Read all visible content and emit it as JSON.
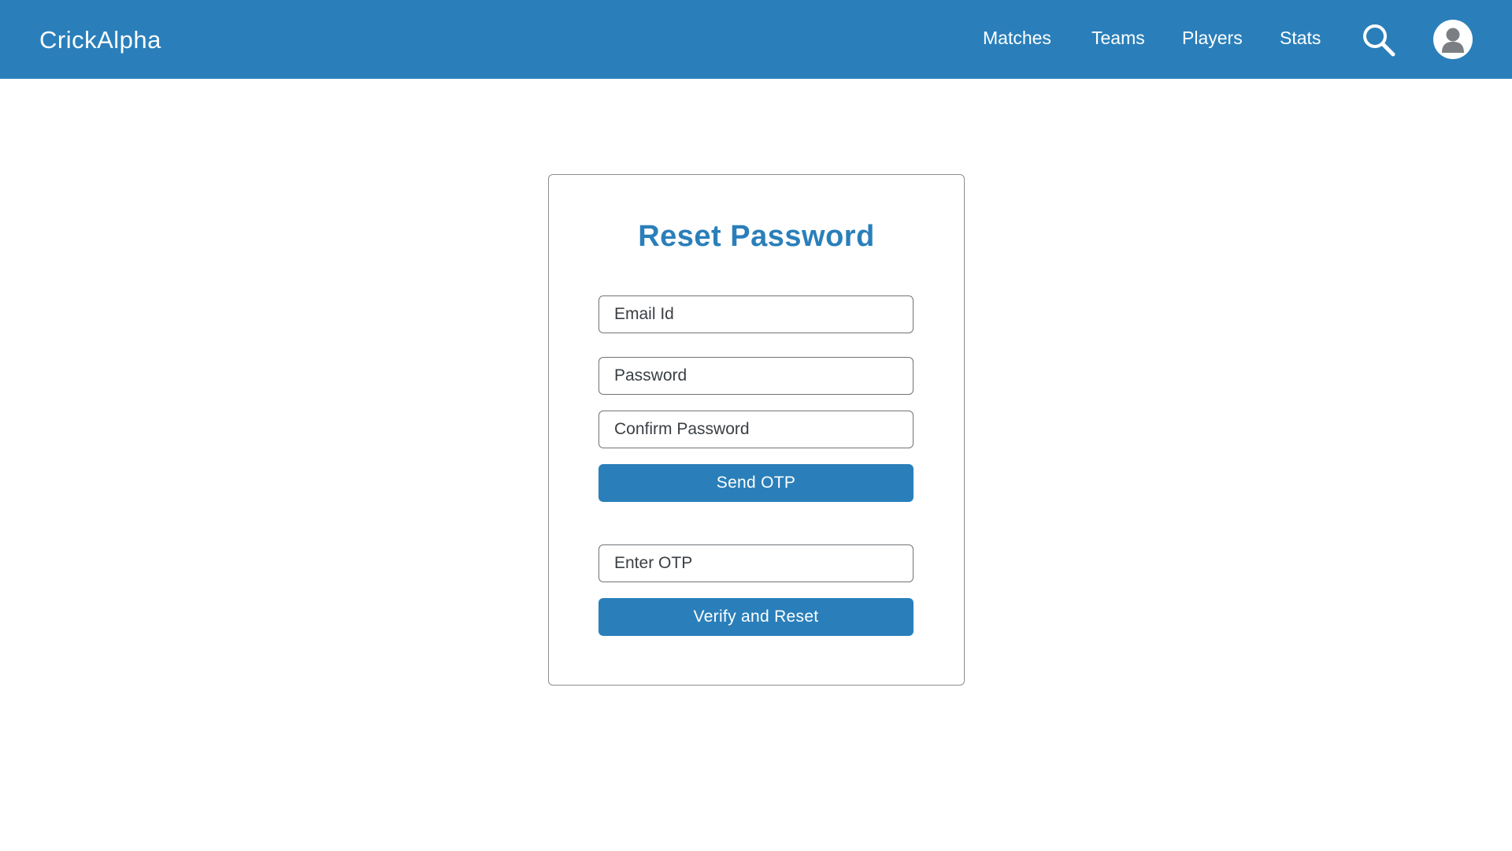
{
  "navbar": {
    "brand": "CrickAlpha",
    "links": [
      {
        "label": "Matches"
      },
      {
        "label": "Teams"
      },
      {
        "label": "Players"
      },
      {
        "label": "Stats"
      }
    ],
    "search_icon": "search-icon",
    "avatar_icon": "user-avatar-icon"
  },
  "form": {
    "title": "Reset Password",
    "email_placeholder": "Email Id",
    "password_placeholder": "Password",
    "confirm_placeholder": "Confirm Password",
    "send_otp_label": "Send OTP",
    "otp_placeholder": "Enter OTP",
    "verify_label": "Verify and Reset"
  },
  "colors": {
    "primary": "#2a7fba",
    "background": "#ffffff",
    "card_border": "#888e94",
    "input_border": "#6e7478"
  }
}
